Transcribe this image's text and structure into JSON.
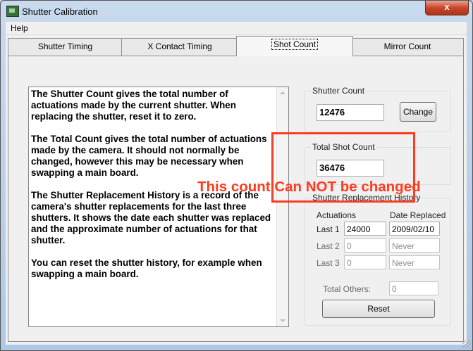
{
  "window": {
    "title": "Shutter Calibration",
    "close_glyph": "x",
    "app_icon": "app-icon"
  },
  "menu": {
    "help": "Help"
  },
  "tabs": [
    {
      "label": "Shutter Timing",
      "active": false
    },
    {
      "label": "X Contact Timing",
      "active": false
    },
    {
      "label": "Shot Count",
      "active": true
    },
    {
      "label": "Mirror Count",
      "active": false
    }
  ],
  "description": "The Shutter Count gives the total number of actuations made by the current shutter. When replacing the shutter, reset it to zero.\n\nThe Total Count gives the total number of actuations made by the camera. It should not normally be changed, however this may be necessary when swapping a main board.\n\nThe Shutter Replacement History is a record of the camera's shutter replacements for the last three shutters. It shows the date each shutter was replaced and the approximate number of actuations for that shutter.\n\nYou can reset the shutter history, for example when swapping a main board.",
  "shutter_count": {
    "legend": "Shutter Count",
    "value": "12476",
    "button": "Change"
  },
  "total_shot_count": {
    "legend": "Total Shot Count",
    "value": "36476"
  },
  "history": {
    "legend": "Shutter Replacement History",
    "col_actuations": "Actuations",
    "col_date": "Date Replaced",
    "rows": [
      {
        "label": "Last 1",
        "actuations": "24000",
        "date": "2009/02/10"
      },
      {
        "label": "Last 2",
        "actuations": "0",
        "date": "Never"
      },
      {
        "label": "Last 3",
        "actuations": "0",
        "date": "Never"
      }
    ],
    "total_others_label": "Total Others:",
    "total_others_value": "0",
    "reset_button": "Reset"
  },
  "annotation": "This count Can NOT be changed",
  "colors": {
    "annotation_red": "#ff3b1f",
    "title_bar": "#c9daee"
  }
}
